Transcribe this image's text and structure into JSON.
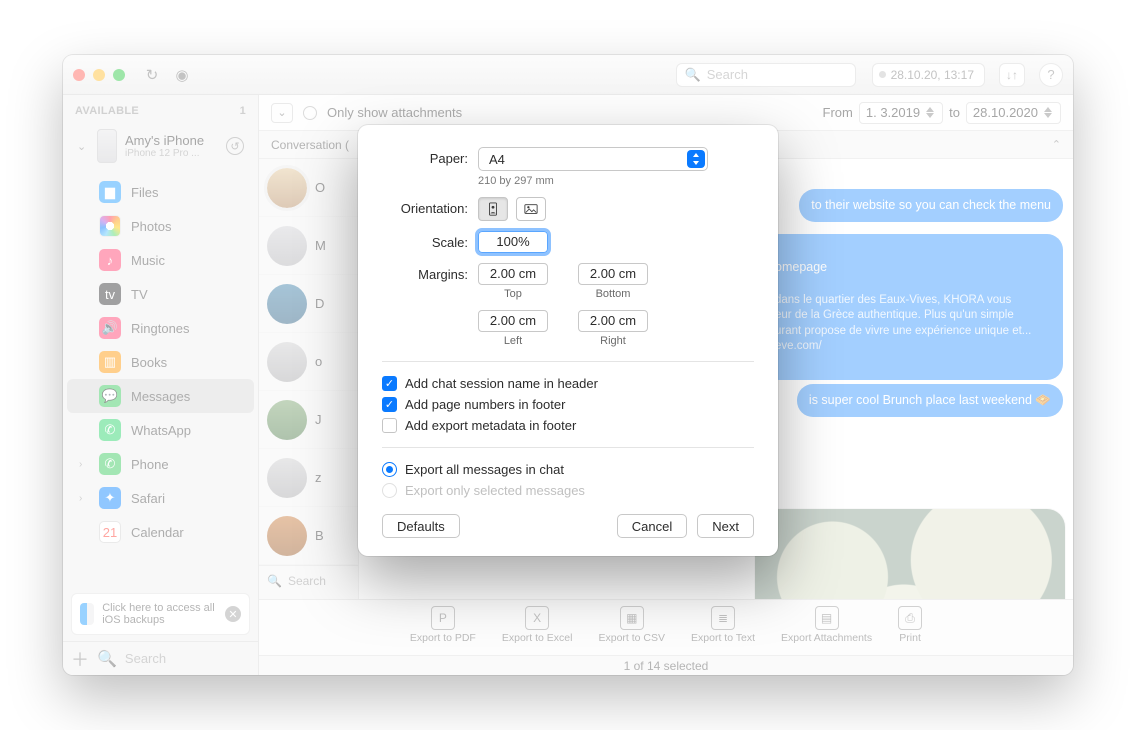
{
  "titlebar": {
    "search_placeholder": "Search",
    "date_badge": "28.10.20, 13:17"
  },
  "sidebar": {
    "section_label": "AVAILABLE",
    "section_count": "1",
    "device": {
      "name": "Amy's iPhone",
      "model": "iPhone 12 Pro ..."
    },
    "items": [
      {
        "label": "Files"
      },
      {
        "label": "Photos"
      },
      {
        "label": "Music"
      },
      {
        "label": "TV"
      },
      {
        "label": "Ringtones"
      },
      {
        "label": "Books"
      },
      {
        "label": "Messages"
      },
      {
        "label": "WhatsApp"
      },
      {
        "label": "Phone"
      },
      {
        "label": "Safari"
      },
      {
        "label": "Calendar"
      }
    ],
    "tip": "Click here to access all iOS backups",
    "footer_search_placeholder": "Search"
  },
  "filterbar": {
    "only_attachments_label": "Only show attachments",
    "from_label": "From",
    "from_date": "1.  3.2019",
    "to_label": "to",
    "to_date": "28.10.2020"
  },
  "conversations": {
    "header": "Conversation (",
    "search_placeholder": "Search",
    "rows": [
      {
        "initial": "O"
      },
      {
        "initial": "M"
      },
      {
        "initial": "D"
      },
      {
        "initial": "o"
      },
      {
        "initial": "J"
      },
      {
        "initial": "z"
      },
      {
        "initial": "B"
      }
    ]
  },
  "messages": {
    "b1": "to their website so you can check the menu",
    "b2": "omepage",
    "b3": " dans le quartier des Eaux-Vives, KHORA vous\n eur de la Grèce authentique. Plus qu'un simple\n urant propose de vivre une expérience unique et...\n eve.com/",
    "b4": "is super cool Brunch place last weekend 🧇"
  },
  "bottombar": {
    "pdf": "Export to PDF",
    "excel": "Export to Excel",
    "csv": "Export to CSV",
    "text": "Export to Text",
    "attach": "Export Attachments",
    "print": "Print"
  },
  "status": "1 of 14 selected",
  "sheet": {
    "paper_label": "Paper:",
    "paper_value": "A4",
    "paper_dims": "210 by 297 mm",
    "orientation_label": "Orientation:",
    "scale_label": "Scale:",
    "scale_value": "100%",
    "margins_label": "Margins:",
    "margins": {
      "top": "2.00 cm",
      "top_cap": "Top",
      "bottom": "2.00 cm",
      "bottom_cap": "Bottom",
      "left": "2.00 cm",
      "left_cap": "Left",
      "right": "2.00 cm",
      "right_cap": "Right"
    },
    "chk_header": "Add chat session name in header",
    "chk_pagenum": "Add page numbers in footer",
    "chk_meta": "Add export metadata in footer",
    "rad_all": "Export all messages in chat",
    "rad_sel": "Export only selected messages",
    "btn_defaults": "Defaults",
    "btn_cancel": "Cancel",
    "btn_next": "Next"
  }
}
